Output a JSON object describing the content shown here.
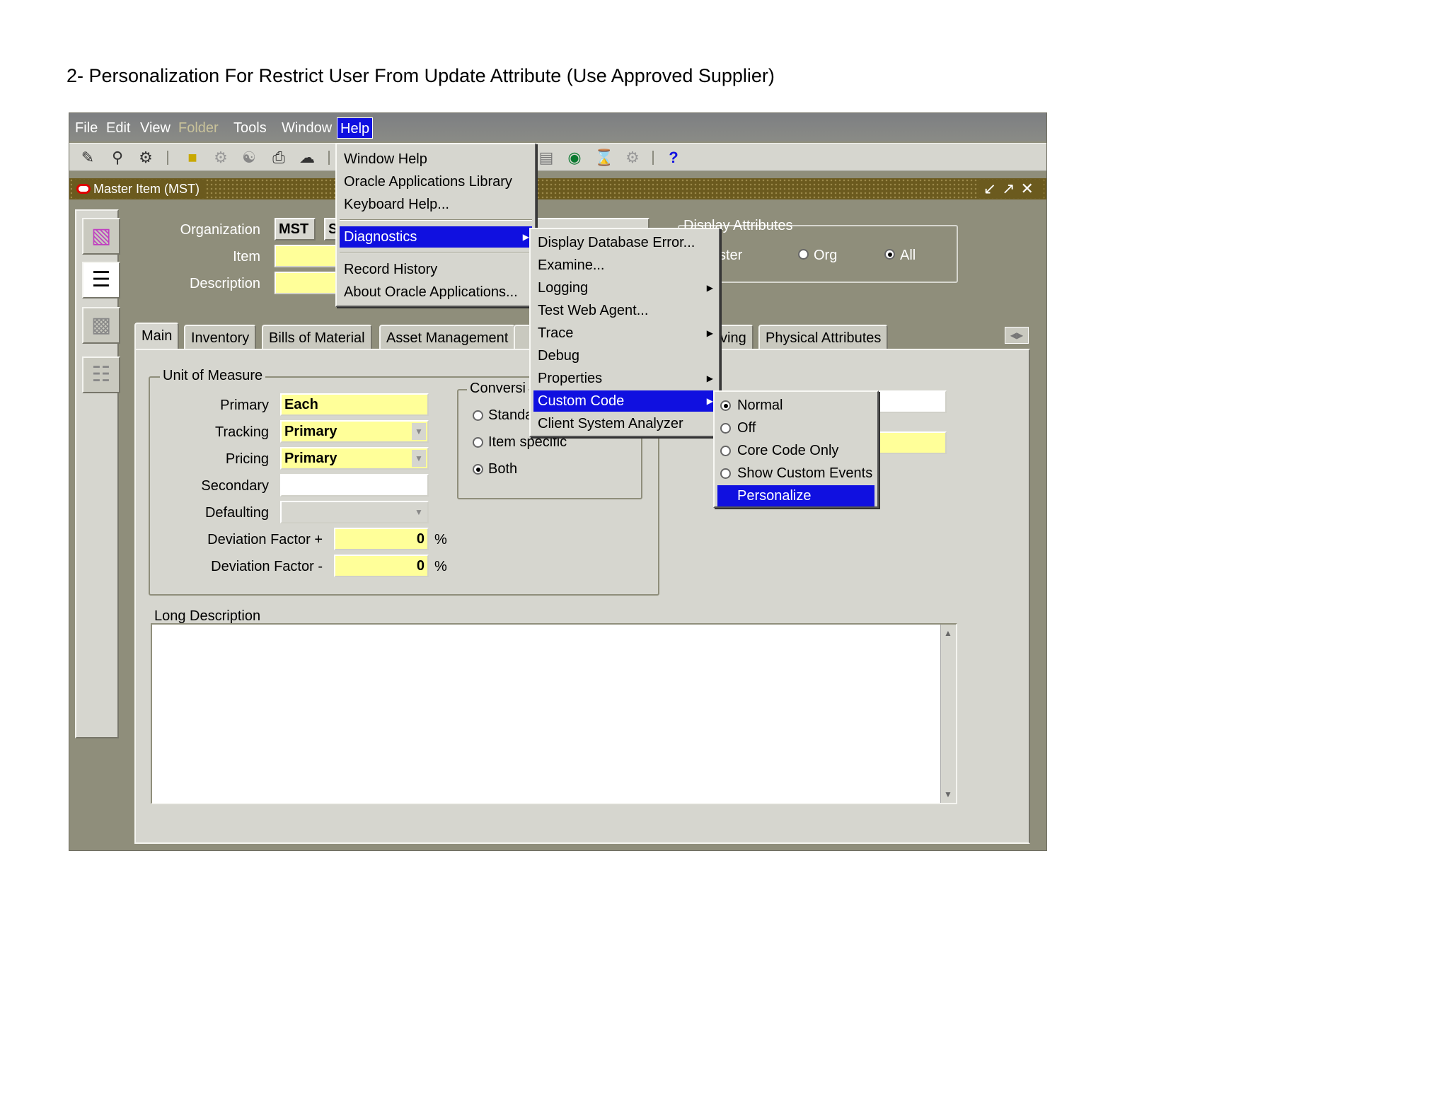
{
  "doc": {
    "title": "2- Personalization For Restrict User From Update Attribute (Use Approved Supplier)"
  },
  "menubar": {
    "items": [
      "File",
      "Edit",
      "View",
      "Folder",
      "Tools",
      "Window",
      "Help"
    ]
  },
  "window": {
    "title": "Master Item (MST)"
  },
  "header": {
    "organization_label": "Organization",
    "organization_value": "MST",
    "organization_value2": "S",
    "item_label": "Item",
    "description_label": "Description"
  },
  "display_attributes": {
    "label": "Display Attributes",
    "options": [
      "ster",
      "Org",
      "All"
    ],
    "selected": "All"
  },
  "tabs": [
    "Main",
    "Inventory",
    "Bills of Material",
    "Asset Management",
    "ving",
    "Physical Attributes"
  ],
  "uom": {
    "group_label": "Unit of Measure",
    "primary_label": "Primary",
    "primary_value": "Each",
    "tracking_label": "Tracking",
    "tracking_value": "Primary",
    "pricing_label": "Pricing",
    "pricing_value": "Primary",
    "secondary_label": "Secondary",
    "defaulting_label": "Defaulting",
    "dev_plus_label": "Deviation Factor +",
    "dev_plus_value": "0",
    "dev_minus_label": "Deviation Factor -",
    "dev_minus_value": "0",
    "percent": "%"
  },
  "conversion": {
    "group_label": "Conversi",
    "options": [
      "Standa",
      "Item specific",
      "Both"
    ],
    "selected": "Both"
  },
  "long_description_label": "Long Description",
  "help_menu": {
    "items": [
      "Window Help",
      "Oracle Applications Library",
      "Keyboard Help...",
      "Diagnostics",
      "Record History",
      "About Oracle Applications..."
    ]
  },
  "diagnostics_menu": {
    "items": [
      "Display Database Error...",
      "Examine...",
      "Logging",
      "Test Web Agent...",
      "Trace",
      "Debug",
      "Properties",
      "Custom Code",
      "Client System Analyzer"
    ]
  },
  "custom_code_menu": {
    "items": [
      "Normal",
      "Off",
      "Core Code Only",
      "Show Custom Events",
      "Personalize"
    ],
    "selected": "Normal"
  },
  "colors": {
    "highlight": "#1010e0",
    "required_field": "#ffff99",
    "canvas": "#8f8e7b",
    "panel": "#d6d6cf"
  }
}
